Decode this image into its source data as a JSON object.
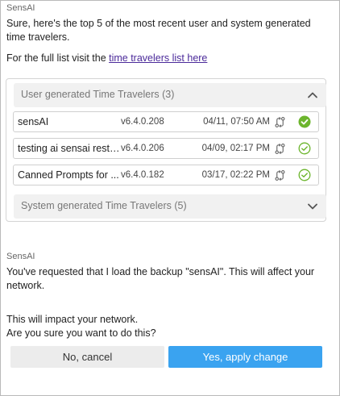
{
  "messages": [
    {
      "sender": "SensAI",
      "text_line1": "Sure, here's the top 5 of the most recent user and system generated",
      "text_line2": "time travelers.",
      "full_list_prefix": "For the full list visit the ",
      "full_list_link": "time travelers list here"
    },
    {
      "sender": "SensAI",
      "line1": "You've requested that I load the backup \"sensAI\". This will affect your",
      "line2": "network.",
      "line3": "This will impact your network.",
      "line4": "Are you sure you want to do this?"
    }
  ],
  "user_group": {
    "title": "User generated Time Travelers (3)",
    "expanded": true,
    "rows": [
      {
        "name": "sensAI",
        "version": "v6.4.0.208",
        "date": "04/11, 07:50 AM",
        "status": "selected"
      },
      {
        "name": "testing ai sensai resto...",
        "version": "v6.4.0.206",
        "date": "04/09, 02:17 PM",
        "status": "ok"
      },
      {
        "name": "Canned Prompts for ...",
        "version": "v6.4.0.182",
        "date": "03/17, 02:22 PM",
        "status": "ok"
      }
    ]
  },
  "system_group": {
    "title": "System generated Time Travelers (5)",
    "expanded": false
  },
  "buttons": {
    "cancel": "No, cancel",
    "apply": "Yes, apply change"
  },
  "colors": {
    "accent": "#3aa3f0",
    "success": "#6cb52d",
    "link": "#4b2a9a"
  }
}
